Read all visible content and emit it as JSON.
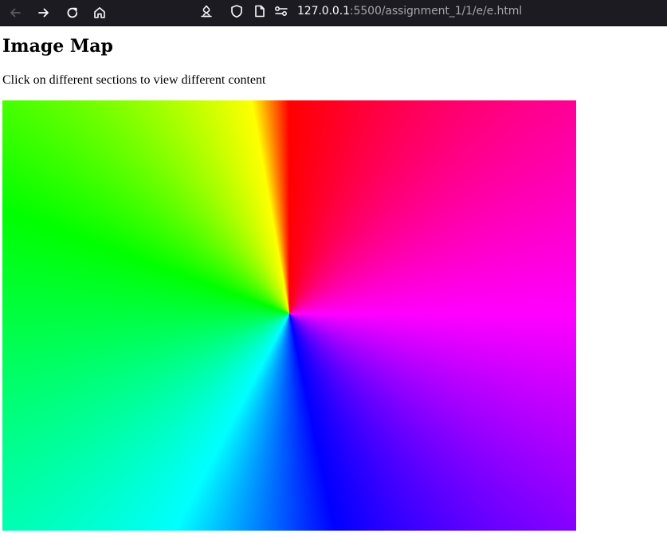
{
  "browser": {
    "url_host": "127.0.0.1",
    "url_path": ":5500/assignment_1/1/e/e.html",
    "icons": {
      "back": "arrow-left-icon",
      "forward": "arrow-right-icon",
      "reload": "reload-icon",
      "home": "home-icon",
      "extensions": "extension-star-icon",
      "tracking": "shield-icon",
      "page_info": "page-icon",
      "permissions": "permissions-icon"
    },
    "colors": {
      "toolbar_bg": "#1c1b22",
      "url_host": "#fbfbfe",
      "url_path": "#a6a5ad"
    }
  },
  "page": {
    "title": "Image Map",
    "description": "Click on different sections to view different content"
  }
}
